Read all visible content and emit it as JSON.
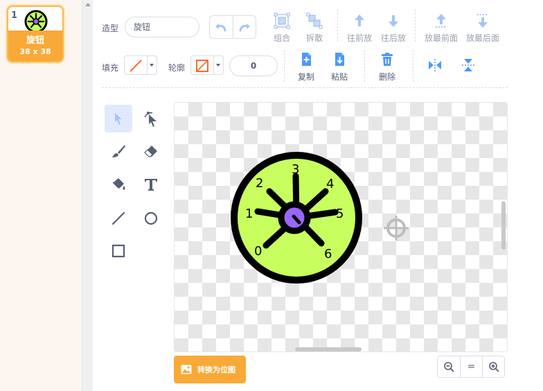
{
  "costume": {
    "number": "1",
    "name": "旋钮",
    "size": "38 x 38"
  },
  "toolbar": {
    "costume_label": "造型",
    "costume_name": "旋钮",
    "fill_label": "填充",
    "outline_label": "轮廓",
    "outline_width": "0",
    "group": "组合",
    "ungroup": "拆散",
    "forward": "往前放",
    "backward": "往后放",
    "front": "放最前面",
    "back": "放最后面",
    "copy": "复制",
    "paste": "粘贴",
    "delete": "删除"
  },
  "canvas": {
    "dial_numbers": [
      "0",
      "1",
      "2",
      "3",
      "4",
      "5",
      "6"
    ]
  },
  "bottom": {
    "convert_bitmap": "转换为位图",
    "zoom_reset": "="
  },
  "colors": {
    "accent": "#f9a937",
    "dial_fill": "#c8ff5e",
    "knob_purple": "#9966ff",
    "icon_blue": "#4c97ff"
  }
}
